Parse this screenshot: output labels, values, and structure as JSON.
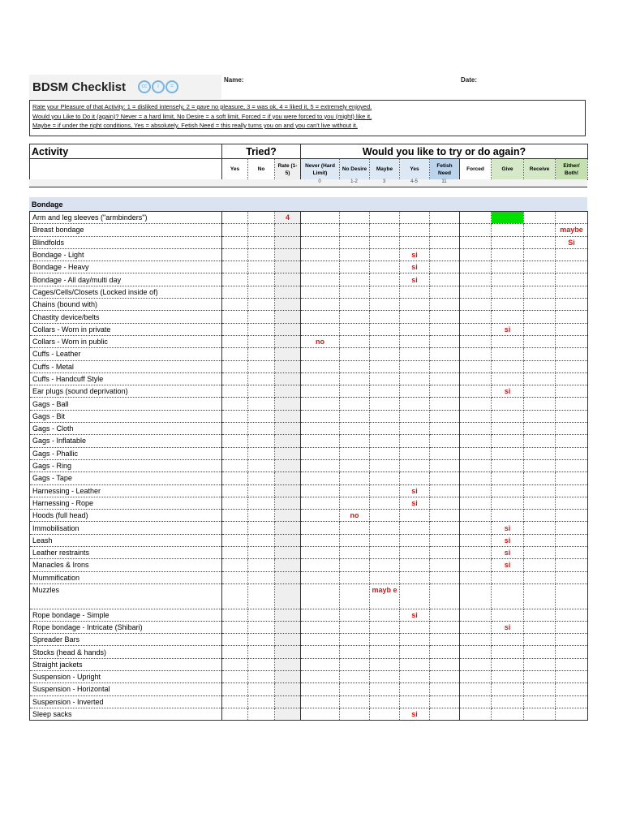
{
  "title": "BDSM Checklist",
  "license_icons": [
    "cc",
    "by",
    "nd"
  ],
  "name_label": "Name:",
  "date_label": "Date:",
  "legend": [
    "Rate your Pleasure of that Activity:    1 = disliked intensely, 2 = gave no pleasure, 3 = was ok, 4 = liked it, 5 = extremely enjoyed.",
    "Would you Like to Do it (again)?        Never = a hard limit, No Desire = a soft limit, Forced = if you were forced to you (might) like it,",
    "     Maybe = if under the right conditions, Yes = absolutely,  Fetish Need = this really turns you on and you can't live without it."
  ],
  "header": {
    "activity": "Activity",
    "tried": "Tried?",
    "again": "Would you like to try or do again?"
  },
  "columns": [
    {
      "key": "yes_t",
      "label": "Yes",
      "bg": "#ffffff"
    },
    {
      "key": "no_t",
      "label": "No",
      "bg": "#ffffff"
    },
    {
      "key": "rate",
      "label": "Rate (1-5)",
      "bg": "#efefef"
    },
    {
      "key": "never",
      "label": "Never (Hard Limit)",
      "bg": "#dde8f5",
      "scale": "0"
    },
    {
      "key": "nodesire",
      "label": "No Desire",
      "bg": "#dde8f5",
      "scale": "1-2"
    },
    {
      "key": "maybe",
      "label": "Maybe",
      "bg": "#dde8f5",
      "scale": "3"
    },
    {
      "key": "yes",
      "label": "Yes",
      "bg": "#dde8f5",
      "scale": "4-5"
    },
    {
      "key": "fetish",
      "label": "Fetish Need",
      "bg": "#bcd3ec",
      "scale": "11"
    },
    {
      "key": "forced",
      "label": "Forced",
      "bg": "#ffffff"
    },
    {
      "key": "give",
      "label": "Give",
      "bg": "#d5e8c8"
    },
    {
      "key": "receive",
      "label": "Receive",
      "bg": "#d5e8c8"
    },
    {
      "key": "either",
      "label": "Either/ Both!",
      "bg": "#c4dfb0"
    }
  ],
  "section": "Bondage",
  "highlight_color": "#00e000",
  "rows": [
    {
      "label": "Arm and leg sleeves (\"armbinders\")",
      "marks": {
        "rate": "4"
      },
      "highlight": "give"
    },
    {
      "label": "Breast bondage",
      "marks": {
        "either": "maybe"
      }
    },
    {
      "label": "Blindfolds",
      "marks": {
        "either": "Si"
      }
    },
    {
      "label": "Bondage - Light",
      "marks": {
        "yes": "si"
      }
    },
    {
      "label": "Bondage - Heavy",
      "marks": {
        "yes": "si"
      }
    },
    {
      "label": "Bondage - All day/multi day",
      "marks": {
        "yes": "si"
      }
    },
    {
      "label": "Cages/Cells/Closets (Locked inside of)",
      "marks": {}
    },
    {
      "label": "Chains (bound with)",
      "marks": {}
    },
    {
      "label": "Chastity device/belts",
      "marks": {}
    },
    {
      "label": "Collars - Worn in private",
      "marks": {
        "give": "si"
      }
    },
    {
      "label": "Collars - Worn in public",
      "marks": {
        "never": "no"
      }
    },
    {
      "label": "Cuffs - Leather",
      "marks": {}
    },
    {
      "label": "Cuffs - Metal",
      "marks": {}
    },
    {
      "label": "Cuffs - Handcuff Style",
      "marks": {}
    },
    {
      "label": "Ear plugs (sound deprivation)",
      "marks": {
        "give": "si"
      }
    },
    {
      "label": "Gags - Ball",
      "marks": {}
    },
    {
      "label": "Gags - Bit",
      "marks": {}
    },
    {
      "label": "Gags - Cloth",
      "marks": {}
    },
    {
      "label": "Gags - Inflatable",
      "marks": {}
    },
    {
      "label": "Gags - Phallic",
      "marks": {}
    },
    {
      "label": "Gags - Ring",
      "marks": {}
    },
    {
      "label": "Gags - Tape",
      "marks": {}
    },
    {
      "label": "Harnessing - Leather",
      "marks": {
        "yes": "si"
      }
    },
    {
      "label": "Harnessing - Rope",
      "marks": {
        "yes": "si"
      }
    },
    {
      "label": "Hoods (full head)",
      "marks": {
        "nodesire": "no"
      }
    },
    {
      "label": "Immobilisation",
      "marks": {
        "give": "si"
      }
    },
    {
      "label": "Leash",
      "marks": {
        "give": "si"
      }
    },
    {
      "label": "Leather restraints",
      "marks": {
        "give": "si"
      }
    },
    {
      "label": "Manacles & Irons",
      "marks": {
        "give": "si"
      }
    },
    {
      "label": "Mummification",
      "marks": {}
    },
    {
      "label": "Muzzles",
      "marks": {
        "maybe": "mayb e"
      },
      "tall": true
    },
    {
      "label": "Rope bondage - Simple",
      "marks": {
        "yes": "si"
      }
    },
    {
      "label": "Rope bondage - Intricate (Shibari)",
      "marks": {
        "give": "si"
      }
    },
    {
      "label": "Spreader Bars",
      "marks": {}
    },
    {
      "label": "Stocks (head & hands)",
      "marks": {}
    },
    {
      "label": "Straight jackets",
      "marks": {}
    },
    {
      "label": "Suspension - Upright",
      "marks": {}
    },
    {
      "label": "Suspension - Horizontal",
      "marks": {}
    },
    {
      "label": "Suspension - Inverted",
      "marks": {}
    },
    {
      "label": "Sleep sacks",
      "marks": {
        "yes": "si"
      }
    }
  ]
}
